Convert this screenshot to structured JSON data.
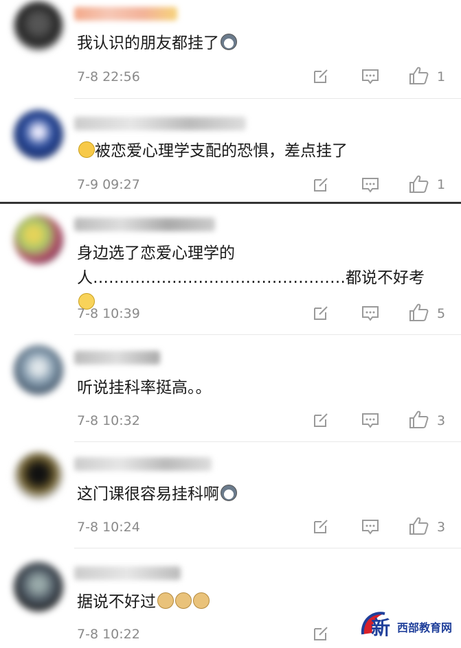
{
  "comments_top": [
    {
      "text": "我认识的朋友都挂了",
      "emoji": "husky",
      "time": "7-8 22:56",
      "likes": "1"
    },
    {
      "text": "被恋爱心理学支配的恐惧，差点挂了",
      "emoji_prefix": "cry",
      "time": "7-9 09:27",
      "likes": "1"
    }
  ],
  "comments_bottom": [
    {
      "text_line1": "身边选了恋爱心理学的",
      "text_line2": "人…………………………………………都说不好考",
      "emoji": "glasses",
      "time": "7-8 10:39",
      "likes": "5"
    },
    {
      "text": "听说挂科率挺高。。",
      "time": "7-8 10:32",
      "likes": "3"
    },
    {
      "text": "这门课很容易挂科啊",
      "emoji": "husky",
      "time": "7-8 10:24",
      "likes": "3"
    },
    {
      "text": "据说不好过",
      "emoji": "doge x3",
      "time": "7-8 10:22",
      "likes": ""
    }
  ],
  "icons": {
    "reply": "reply-edit-icon",
    "comment": "comment-icon",
    "like": "thumbs-up-icon"
  },
  "watermark": {
    "text_main": "新",
    "text_sub": "西部教育网"
  },
  "colors": {
    "meta": "#8a8a8a",
    "text": "#1a1a1a",
    "icon": "#9a9a9a",
    "watermark_blue": "#1f3f9a",
    "watermark_red": "#d8202a"
  }
}
